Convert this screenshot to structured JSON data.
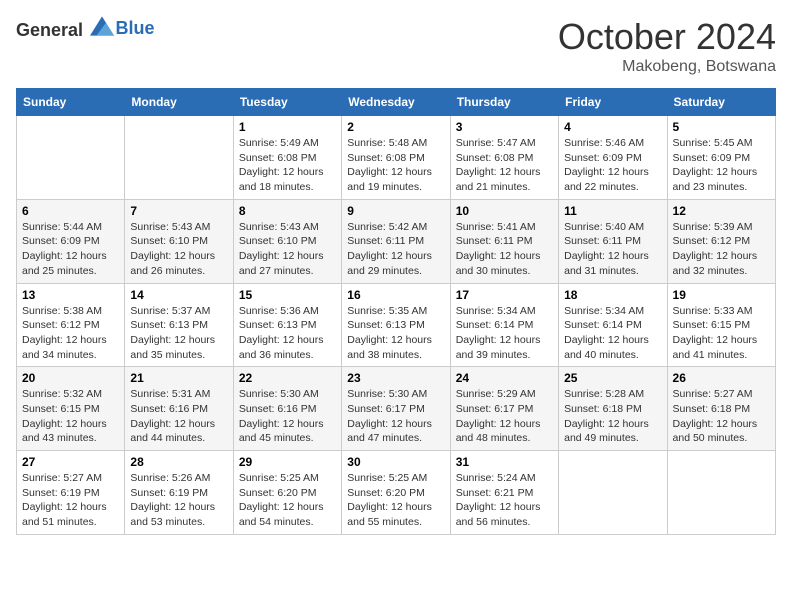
{
  "header": {
    "logo_general": "General",
    "logo_blue": "Blue",
    "month_year": "October 2024",
    "location": "Makobeng, Botswana"
  },
  "days_of_week": [
    "Sunday",
    "Monday",
    "Tuesday",
    "Wednesday",
    "Thursday",
    "Friday",
    "Saturday"
  ],
  "weeks": [
    [
      {
        "day": "",
        "info": ""
      },
      {
        "day": "",
        "info": ""
      },
      {
        "day": "1",
        "info": "Sunrise: 5:49 AM\nSunset: 6:08 PM\nDaylight: 12 hours and 18 minutes."
      },
      {
        "day": "2",
        "info": "Sunrise: 5:48 AM\nSunset: 6:08 PM\nDaylight: 12 hours and 19 minutes."
      },
      {
        "day": "3",
        "info": "Sunrise: 5:47 AM\nSunset: 6:08 PM\nDaylight: 12 hours and 21 minutes."
      },
      {
        "day": "4",
        "info": "Sunrise: 5:46 AM\nSunset: 6:09 PM\nDaylight: 12 hours and 22 minutes."
      },
      {
        "day": "5",
        "info": "Sunrise: 5:45 AM\nSunset: 6:09 PM\nDaylight: 12 hours and 23 minutes."
      }
    ],
    [
      {
        "day": "6",
        "info": "Sunrise: 5:44 AM\nSunset: 6:09 PM\nDaylight: 12 hours and 25 minutes."
      },
      {
        "day": "7",
        "info": "Sunrise: 5:43 AM\nSunset: 6:10 PM\nDaylight: 12 hours and 26 minutes."
      },
      {
        "day": "8",
        "info": "Sunrise: 5:43 AM\nSunset: 6:10 PM\nDaylight: 12 hours and 27 minutes."
      },
      {
        "day": "9",
        "info": "Sunrise: 5:42 AM\nSunset: 6:11 PM\nDaylight: 12 hours and 29 minutes."
      },
      {
        "day": "10",
        "info": "Sunrise: 5:41 AM\nSunset: 6:11 PM\nDaylight: 12 hours and 30 minutes."
      },
      {
        "day": "11",
        "info": "Sunrise: 5:40 AM\nSunset: 6:11 PM\nDaylight: 12 hours and 31 minutes."
      },
      {
        "day": "12",
        "info": "Sunrise: 5:39 AM\nSunset: 6:12 PM\nDaylight: 12 hours and 32 minutes."
      }
    ],
    [
      {
        "day": "13",
        "info": "Sunrise: 5:38 AM\nSunset: 6:12 PM\nDaylight: 12 hours and 34 minutes."
      },
      {
        "day": "14",
        "info": "Sunrise: 5:37 AM\nSunset: 6:13 PM\nDaylight: 12 hours and 35 minutes."
      },
      {
        "day": "15",
        "info": "Sunrise: 5:36 AM\nSunset: 6:13 PM\nDaylight: 12 hours and 36 minutes."
      },
      {
        "day": "16",
        "info": "Sunrise: 5:35 AM\nSunset: 6:13 PM\nDaylight: 12 hours and 38 minutes."
      },
      {
        "day": "17",
        "info": "Sunrise: 5:34 AM\nSunset: 6:14 PM\nDaylight: 12 hours and 39 minutes."
      },
      {
        "day": "18",
        "info": "Sunrise: 5:34 AM\nSunset: 6:14 PM\nDaylight: 12 hours and 40 minutes."
      },
      {
        "day": "19",
        "info": "Sunrise: 5:33 AM\nSunset: 6:15 PM\nDaylight: 12 hours and 41 minutes."
      }
    ],
    [
      {
        "day": "20",
        "info": "Sunrise: 5:32 AM\nSunset: 6:15 PM\nDaylight: 12 hours and 43 minutes."
      },
      {
        "day": "21",
        "info": "Sunrise: 5:31 AM\nSunset: 6:16 PM\nDaylight: 12 hours and 44 minutes."
      },
      {
        "day": "22",
        "info": "Sunrise: 5:30 AM\nSunset: 6:16 PM\nDaylight: 12 hours and 45 minutes."
      },
      {
        "day": "23",
        "info": "Sunrise: 5:30 AM\nSunset: 6:17 PM\nDaylight: 12 hours and 47 minutes."
      },
      {
        "day": "24",
        "info": "Sunrise: 5:29 AM\nSunset: 6:17 PM\nDaylight: 12 hours and 48 minutes."
      },
      {
        "day": "25",
        "info": "Sunrise: 5:28 AM\nSunset: 6:18 PM\nDaylight: 12 hours and 49 minutes."
      },
      {
        "day": "26",
        "info": "Sunrise: 5:27 AM\nSunset: 6:18 PM\nDaylight: 12 hours and 50 minutes."
      }
    ],
    [
      {
        "day": "27",
        "info": "Sunrise: 5:27 AM\nSunset: 6:19 PM\nDaylight: 12 hours and 51 minutes."
      },
      {
        "day": "28",
        "info": "Sunrise: 5:26 AM\nSunset: 6:19 PM\nDaylight: 12 hours and 53 minutes."
      },
      {
        "day": "29",
        "info": "Sunrise: 5:25 AM\nSunset: 6:20 PM\nDaylight: 12 hours and 54 minutes."
      },
      {
        "day": "30",
        "info": "Sunrise: 5:25 AM\nSunset: 6:20 PM\nDaylight: 12 hours and 55 minutes."
      },
      {
        "day": "31",
        "info": "Sunrise: 5:24 AM\nSunset: 6:21 PM\nDaylight: 12 hours and 56 minutes."
      },
      {
        "day": "",
        "info": ""
      },
      {
        "day": "",
        "info": ""
      }
    ]
  ]
}
